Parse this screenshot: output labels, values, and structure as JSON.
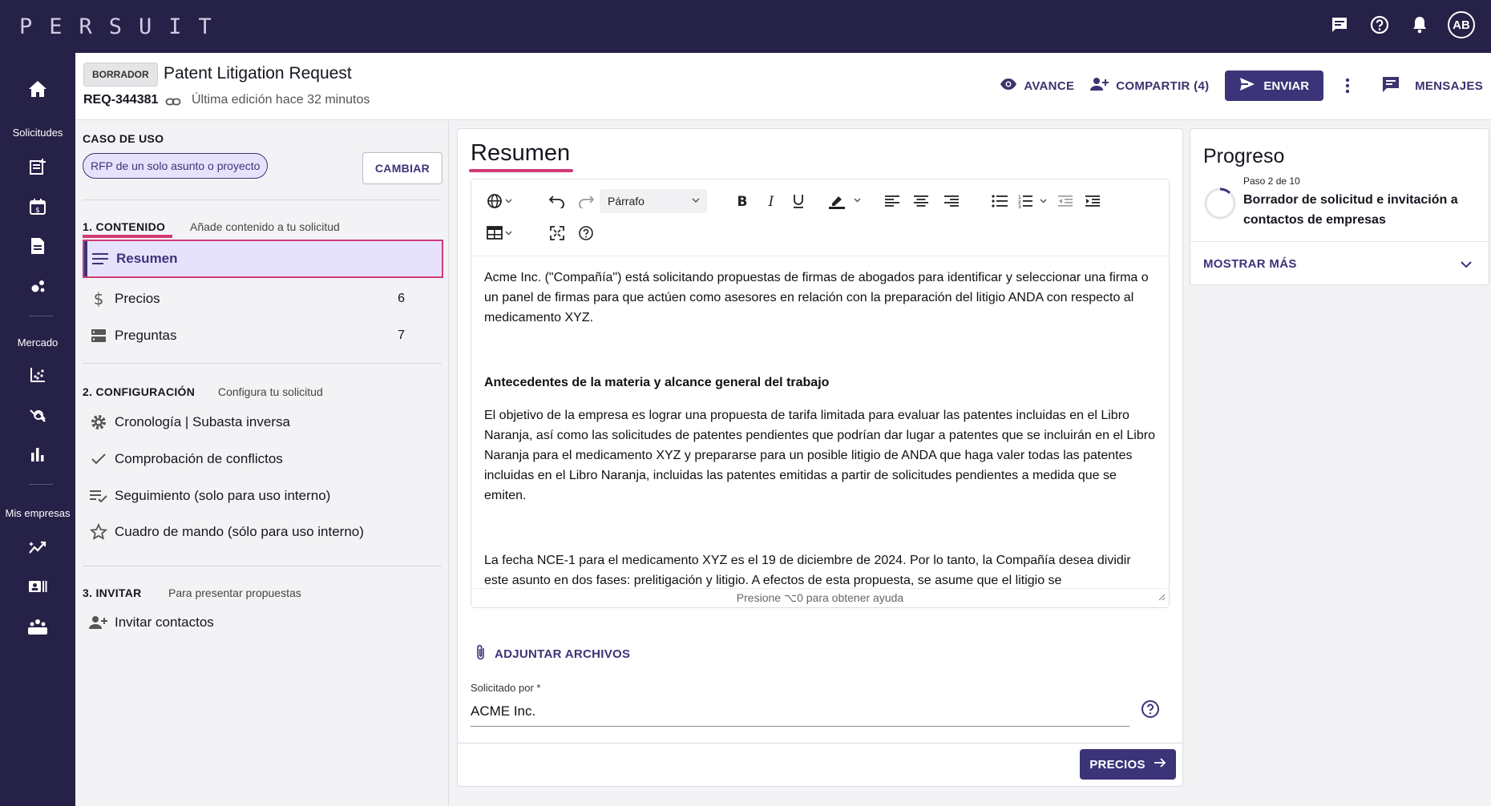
{
  "app": {
    "logo": "PERSUIT",
    "avatar_initials": "AB",
    "top_icons": [
      "chat-icon",
      "help-icon",
      "bell-icon"
    ]
  },
  "rail": {
    "sections": [
      {
        "label": "Solicitudes",
        "items": [
          "new-request-icon",
          "calendar-icon",
          "document-icon",
          "network-icon"
        ]
      },
      {
        "label": "Mercado",
        "items": [
          "scatter-chart-icon",
          "market-search-icon",
          "bar-chart-icon"
        ]
      },
      {
        "label": "Mis empresas",
        "items": [
          "trend-icon",
          "contact-card-icon",
          "team-icon"
        ]
      }
    ],
    "home_icon": "home-icon"
  },
  "header": {
    "status_badge": "BORRADOR",
    "title": "Patent Litigation Request",
    "request_id": "REQ-344381",
    "last_edit": "Última edición hace 32 minutos",
    "preview_label": "AVANCE",
    "share_label": "COMPARTIR (4)",
    "send_label": "ENVIAR",
    "messages_label": "MENSAJES"
  },
  "sidebar": {
    "use_case_label": "CASO DE USO",
    "use_case_value": "RFP de un solo asunto o proyecto",
    "change_label": "CAMBIAR",
    "section1": {
      "label": "1. CONTENIDO",
      "hint": "Añade contenido a tu solicitud",
      "items": [
        {
          "label": "Resumen",
          "count": ""
        },
        {
          "label": "Precios",
          "count": "6"
        },
        {
          "label": "Preguntas",
          "count": "7"
        }
      ]
    },
    "section2": {
      "label": "2. CONFIGURACIÓN",
      "hint": "Configura tu solicitud",
      "items": [
        {
          "label": "Cronología | Subasta inversa"
        },
        {
          "label": "Comprobación de conflictos"
        },
        {
          "label": "Seguimiento (solo para uso interno)"
        },
        {
          "label": "Cuadro de mando (sólo para uso interno)"
        }
      ]
    },
    "section3": {
      "label": "3. INVITAR",
      "hint": "Para presentar propuestas",
      "items": [
        {
          "label": "Invitar contactos"
        }
      ]
    }
  },
  "editor": {
    "title": "Resumen",
    "paragraph_style": "Párrafo",
    "body": {
      "p1": "Acme Inc. (\"Compañía\") está solicitando propuestas de firmas de abogados para identificar y seleccionar una firma o un panel de firmas para que actúen como asesores en relación con la preparación del litigio ANDA con respecto al medicamento XYZ.",
      "h1": "Antecedentes de la materia y alcance general del trabajo",
      "p2": "El objetivo de la empresa es lograr una propuesta de tarifa limitada para evaluar las patentes incluidas en el Libro Naranja, así como las solicitudes de patentes pendientes que podrían dar lugar a patentes que se incluirán en el Libro Naranja para el medicamento XYZ y prepararse para un posible litigio de ANDA que haga valer todas las patentes incluidas en el Libro Naranja, incluidas las patentes emitidas a partir de solicitudes pendientes a medida que se emiten.",
      "p3": "La fecha NCE-1 para el medicamento XYZ es el 19 de diciembre de 2024. Por lo tanto, la Compañía desea dividir este asunto en dos fases: prelitigación y litigio. A efectos de esta propuesta, se asume que el litigio se"
    },
    "help_hint": "Presione ⌥0 para obtener ayuda",
    "attach_label": "ADJUNTAR ARCHIVOS",
    "requested_by_label": "Solicitado por  *",
    "requested_by_value": "ACME Inc.",
    "next_label": "PRECIOS"
  },
  "progress": {
    "title": "Progreso",
    "step": "Paso 2 de 10",
    "description": "Borrador de solicitud e invitación a contactos de empresas",
    "show_more": "MOSTRAR MÁS"
  },
  "colors": {
    "nav_bg": "#262147",
    "primary": "#3b3479",
    "accent": "#d23a78",
    "active_bg": "#e7e2fb"
  }
}
